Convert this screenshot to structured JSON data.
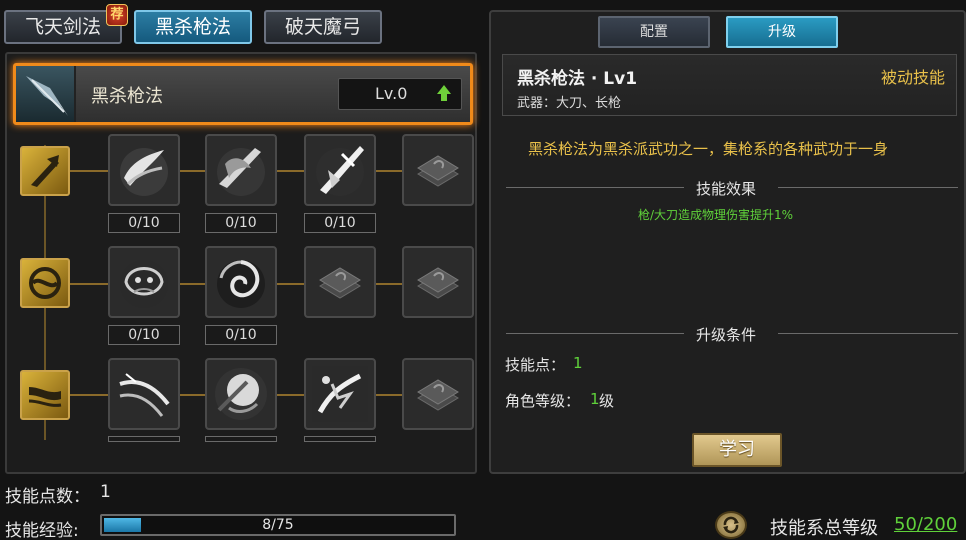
{
  "top_tabs": [
    {
      "label": "飞天剑法",
      "badge": "荐"
    },
    {
      "label": "黑杀枪法",
      "active": true
    },
    {
      "label": "破天魔弓"
    }
  ],
  "skill_header": {
    "name": "黑杀枪法",
    "level": "Lv.0"
  },
  "tree": {
    "rows": [
      {
        "icon": "spear-row-icon",
        "slots": [
          {
            "icon": "spear-whirl-icon",
            "count": "0/10"
          },
          {
            "icon": "dragon-spear-icon",
            "count": "0/10"
          },
          {
            "icon": "spear-burst-icon",
            "count": "0/10"
          },
          {
            "icon": "locked-scroll-icon"
          }
        ]
      },
      {
        "icon": "swirl-row-icon",
        "slots": [
          {
            "icon": "demon-face-icon",
            "count": "0/10"
          },
          {
            "icon": "vortex-icon",
            "count": "0/10"
          },
          {
            "icon": "locked-scroll-icon"
          },
          {
            "icon": "locked-scroll-icon"
          }
        ]
      },
      {
        "icon": "wave-row-icon",
        "slots": [
          {
            "icon": "wind-slash-icon"
          },
          {
            "icon": "warrior-strike-icon"
          },
          {
            "icon": "shadow-burst-icon"
          },
          {
            "icon": "locked-scroll-icon"
          }
        ]
      }
    ]
  },
  "detail_tabs": [
    "配置",
    "升级"
  ],
  "detail": {
    "title": "黑杀枪法 · Lv1",
    "type": "被动技能",
    "weapons": "武器：大刀、长枪",
    "description": "黑杀枪法为黑杀派武功之一，集枪系的各种武功于一身",
    "effect_heading": "技能效果",
    "effect": "枪/大刀造成物理伤害提升1%",
    "conditions_heading": "升级条件",
    "cond_points_label": "技能点：",
    "cond_points_value": "1",
    "cond_level_label": "角色等级：",
    "cond_level_value": "1",
    "cond_level_unit": "级",
    "learn_button": "学习"
  },
  "bottom": {
    "points_label": "技能点数：",
    "points_value": "1",
    "exp_label": "技能经验:",
    "exp_text": "8/75",
    "exp_fraction": 0.107,
    "total_label": "技能系总等级",
    "total_value": "50/200"
  },
  "colors": {
    "accent_orange": "#f08a1a",
    "gold_text": "#e8c04a",
    "green_text": "#5fd13a",
    "teal_tab": "#2a9bc2"
  }
}
